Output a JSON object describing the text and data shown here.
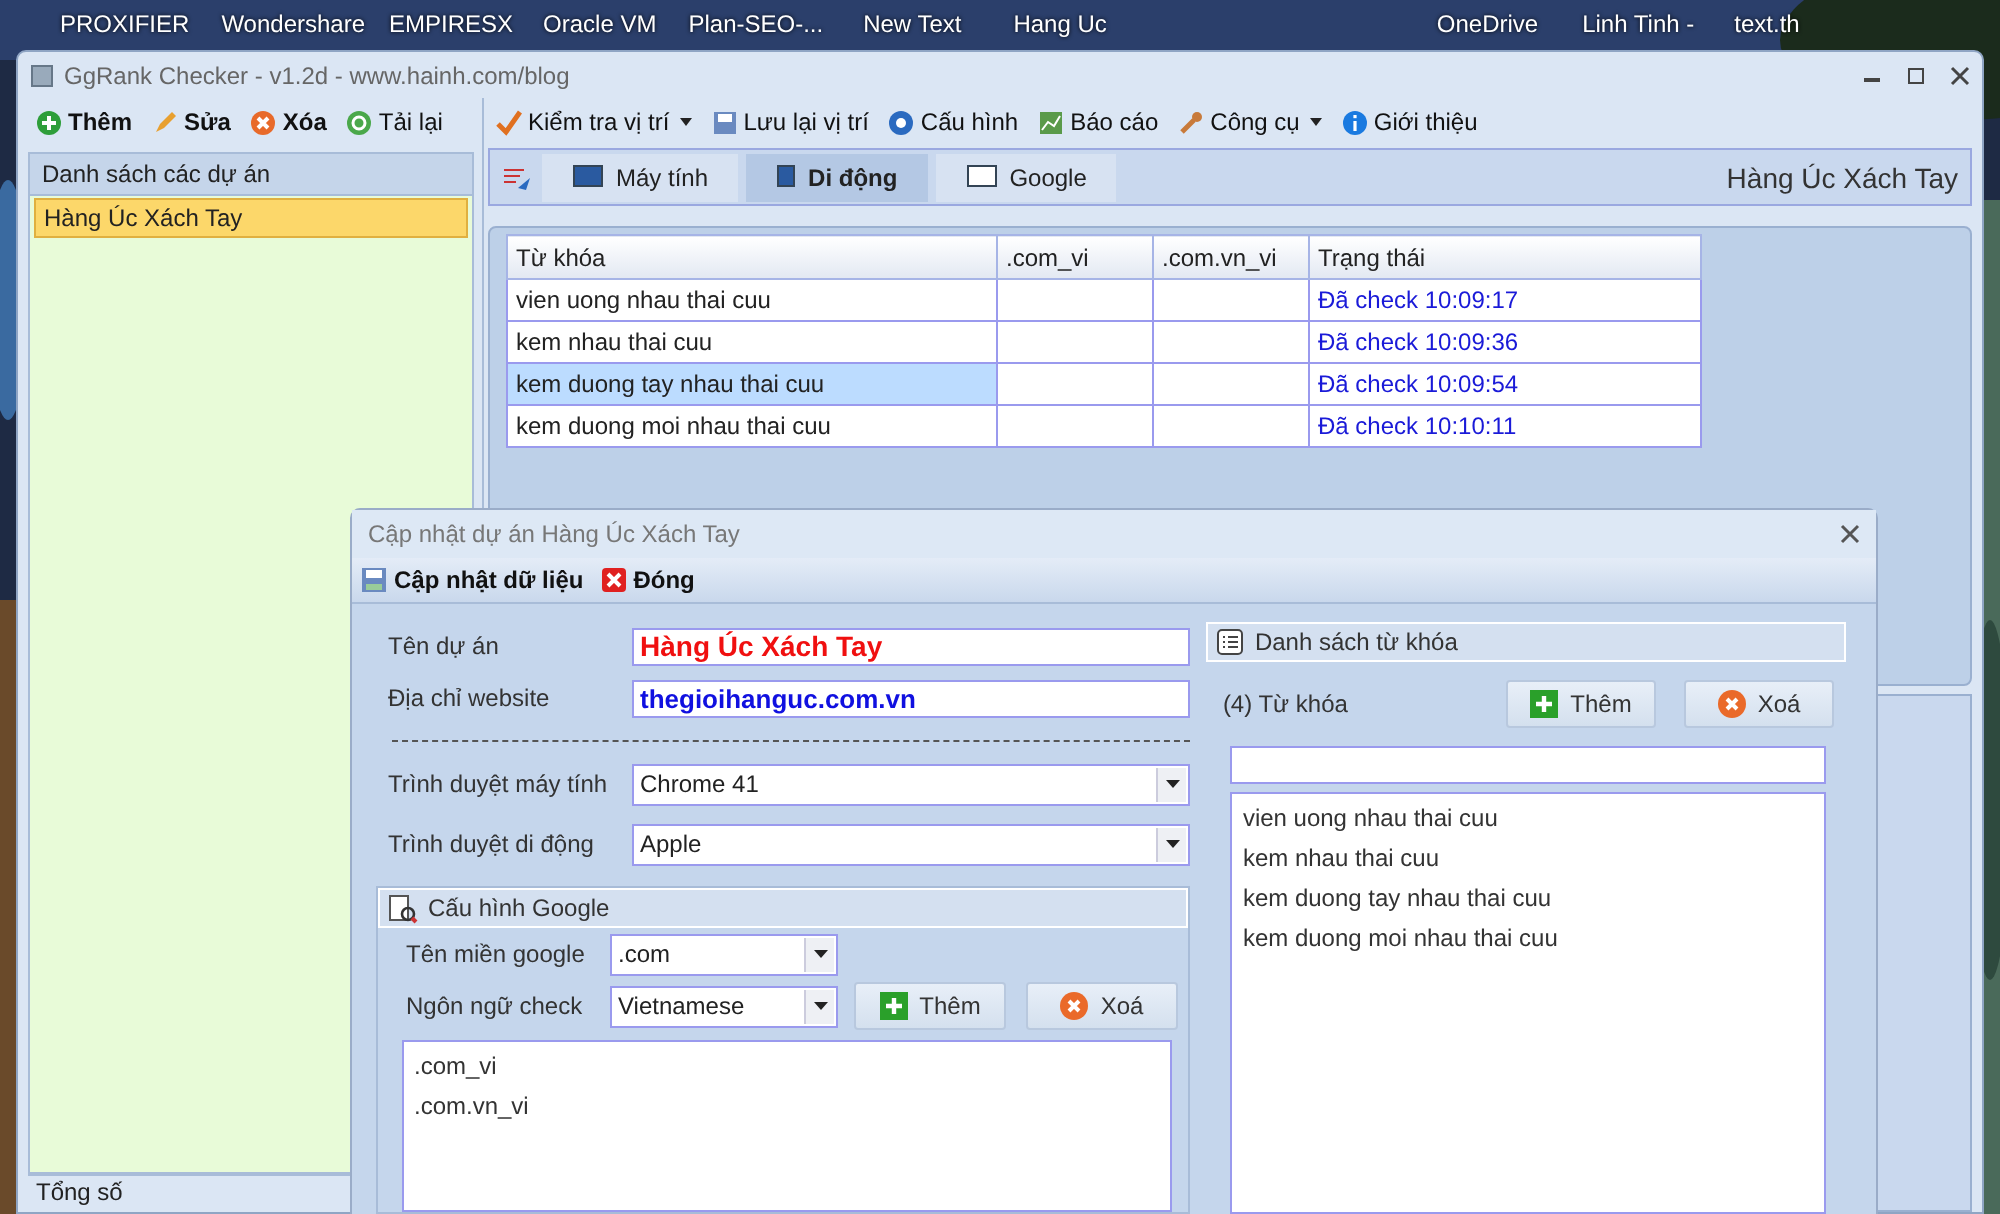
{
  "desktop": {
    "icons": [
      "PROXIFIER",
      "Wondershare",
      "EMPIRESX",
      "Oracle VM",
      "Plan-SEO-...",
      "New Text",
      "Hang Uc",
      "OneDrive",
      "Linh Tinh -",
      "text.th"
    ]
  },
  "window": {
    "title": "GgRank Checker - v1.2d - www.hainh.com/blog"
  },
  "project_toolbar": [
    "Thêm",
    "Sửa",
    "Xóa",
    "Tải lại"
  ],
  "main_toolbar": [
    {
      "label": "Kiểm tra vị trí",
      "dropdown": true
    },
    {
      "label": "Lưu lại vị trí",
      "dropdown": false
    },
    {
      "label": "Cấu hình",
      "dropdown": false
    },
    {
      "label": "Báo cáo",
      "dropdown": false
    },
    {
      "label": "Công cụ",
      "dropdown": true
    },
    {
      "label": "Giới thiệu",
      "dropdown": false
    }
  ],
  "sidebar": {
    "header": "Danh sách các dự án",
    "items": [
      {
        "label": "Hàng Úc Xách Tay",
        "selected": true
      }
    ],
    "footer": "Tổng số"
  },
  "tabs": [
    {
      "label": "Máy tính",
      "selected": false
    },
    {
      "label": "Di động",
      "selected": true
    },
    {
      "label": "Google",
      "selected": false
    }
  ],
  "project_name": "Hàng Úc Xách Tay",
  "table": {
    "columns": [
      "Từ khóa",
      ".com_vi",
      ".com.vn_vi",
      "Trạng thái"
    ],
    "rows": [
      {
        "keyword": "vien uong nhau thai cuu",
        "com_vi": "",
        "com_vn_vi": "",
        "status": "Đã check 10:09:17",
        "selected": false
      },
      {
        "keyword": "kem nhau thai cuu",
        "com_vi": "",
        "com_vn_vi": "",
        "status": "Đã check 10:09:36",
        "selected": false
      },
      {
        "keyword": "kem duong tay nhau thai cuu",
        "com_vi": "",
        "com_vn_vi": "",
        "status": "Đã check 10:09:54",
        "selected": true
      },
      {
        "keyword": "kem duong moi nhau thai cuu",
        "com_vi": "",
        "com_vn_vi": "",
        "status": "Đã check 10:10:11",
        "selected": false
      }
    ]
  },
  "dialog": {
    "title": "Cập nhật dự án Hàng Úc Xách Tay",
    "toolbar": [
      "Cập nhật dữ liệu",
      "Đóng"
    ],
    "fields": [
      {
        "label": "Tên dự án",
        "value": "Hàng Úc Xách Tay"
      },
      {
        "label": "Địa chỉ website",
        "value": "thegioihanguc.com.vn"
      }
    ],
    "browsers": [
      {
        "label": "Trình duyệt máy tính",
        "value": "Chrome 41"
      },
      {
        "label": "Trình duyệt di động",
        "value": "Apple"
      }
    ],
    "google": {
      "title": "Cấu hình Google",
      "domain_label": "Tên miền google",
      "domain": ".com",
      "language_label": "Ngôn ngữ check",
      "language": "Vietnamese",
      "add": "Thêm",
      "remove": "Xoá",
      "items": [
        ".com_vi",
        ".com.vn_vi"
      ]
    },
    "keywords": {
      "title": "Danh sách từ khóa",
      "count": "(4) Từ khóa",
      "add": "Thêm",
      "remove": "Xoá",
      "items": [
        "vien uong nhau thai cuu",
        "kem nhau thai cuu",
        "kem duong tay nhau thai cuu",
        "kem duong moi nhau thai cuu"
      ]
    }
  }
}
